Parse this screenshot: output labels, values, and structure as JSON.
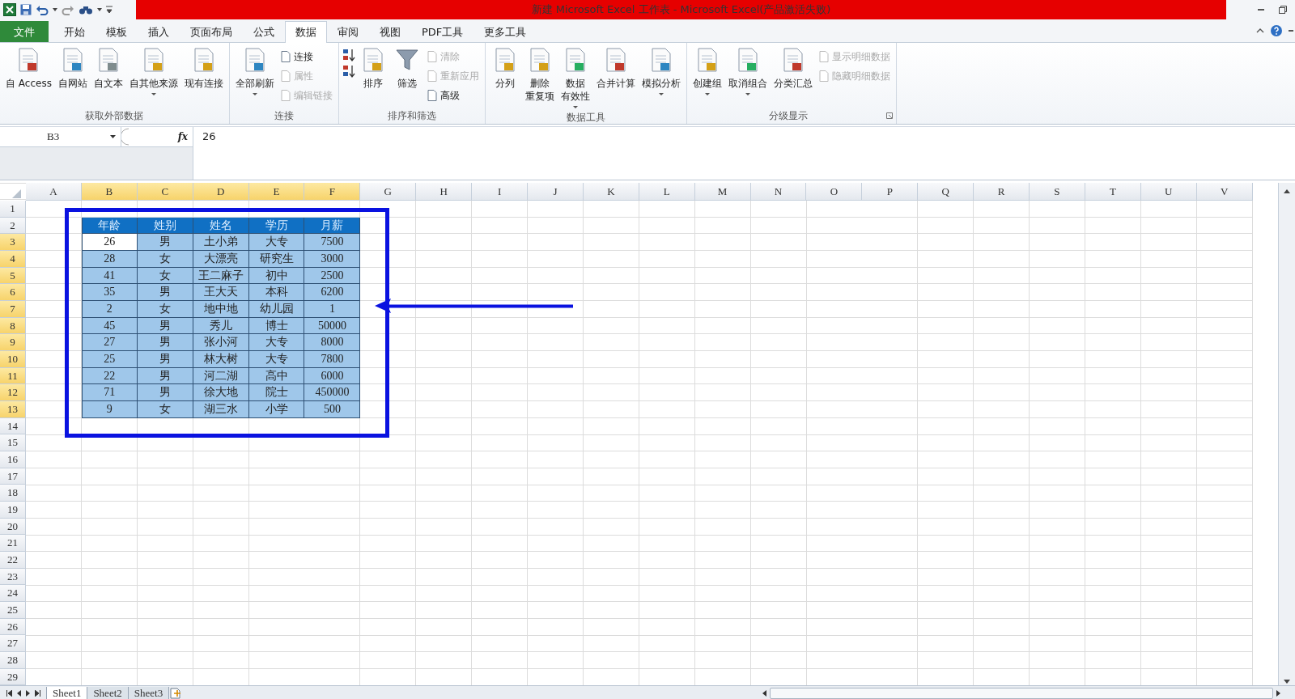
{
  "window": {
    "title": "新建 Microsoft Excel 工作表 - Microsoft Excel(产品激活失败)"
  },
  "menu_tabs": [
    {
      "label": "文件",
      "kind": "file",
      "selected": false
    },
    {
      "label": "开始",
      "kind": "tab",
      "selected": false
    },
    {
      "label": "模板",
      "kind": "tab",
      "selected": false
    },
    {
      "label": "插入",
      "kind": "tab",
      "selected": false
    },
    {
      "label": "页面布局",
      "kind": "tab",
      "selected": false
    },
    {
      "label": "公式",
      "kind": "tab",
      "selected": false
    },
    {
      "label": "数据",
      "kind": "tab",
      "selected": true
    },
    {
      "label": "审阅",
      "kind": "tab",
      "selected": false
    },
    {
      "label": "视图",
      "kind": "tab",
      "selected": false
    },
    {
      "label": "PDF工具",
      "kind": "tab",
      "selected": false
    },
    {
      "label": "更多工具",
      "kind": "tab",
      "selected": false
    }
  ],
  "ribbon": {
    "groups": [
      {
        "label": "获取外部数据",
        "launcher": false,
        "items": [
          {
            "label": "自 Access",
            "kind": "large",
            "dropdown": false,
            "disabled": false
          },
          {
            "label": "自网站",
            "kind": "large",
            "dropdown": false,
            "disabled": false
          },
          {
            "label": "自文本",
            "kind": "large",
            "dropdown": false,
            "disabled": false
          },
          {
            "label": "自其他来源",
            "kind": "large",
            "dropdown": true,
            "disabled": false
          },
          {
            "label": "现有连接",
            "kind": "large",
            "dropdown": false,
            "disabled": false
          }
        ]
      },
      {
        "label": "连接",
        "launcher": false,
        "items": [
          {
            "label": "全部刷新",
            "kind": "large",
            "dropdown": true,
            "disabled": false
          },
          {
            "label": "连接",
            "kind": "small",
            "disabled": false
          },
          {
            "label": "属性",
            "kind": "small",
            "disabled": true
          },
          {
            "label": "编辑链接",
            "kind": "small",
            "disabled": true
          }
        ]
      },
      {
        "label": "排序和筛选",
        "launcher": false,
        "items": [
          {
            "kind": "sortup",
            "disabled": false
          },
          {
            "kind": "sortdown",
            "disabled": false
          },
          {
            "label": "排序",
            "kind": "large",
            "dropdown": false,
            "disabled": false
          },
          {
            "label": "筛选",
            "kind": "funnel",
            "dropdown": false,
            "disabled": false
          },
          {
            "label": "清除",
            "kind": "small",
            "disabled": true
          },
          {
            "label": "重新应用",
            "kind": "small",
            "disabled": true
          },
          {
            "label": "高级",
            "kind": "small",
            "disabled": false
          }
        ]
      },
      {
        "label": "数据工具",
        "launcher": false,
        "items": [
          {
            "label": "分列",
            "kind": "large",
            "dropdown": false,
            "disabled": false
          },
          {
            "lines": [
              "删除",
              "重复项"
            ],
            "kind": "large",
            "dropdown": false,
            "disabled": false
          },
          {
            "lines": [
              "数据",
              "有效性"
            ],
            "kind": "large",
            "dropdown": true,
            "disabled": false
          },
          {
            "label": "合并计算",
            "kind": "large",
            "dropdown": false,
            "disabled": false
          },
          {
            "label": "模拟分析",
            "kind": "large",
            "dropdown": true,
            "disabled": false
          }
        ]
      },
      {
        "label": "分级显示",
        "launcher": true,
        "items": [
          {
            "label": "创建组",
            "kind": "large",
            "dropdown": true,
            "disabled": false
          },
          {
            "label": "取消组合",
            "kind": "large",
            "dropdown": true,
            "disabled": false
          },
          {
            "label": "分类汇总",
            "kind": "large",
            "dropdown": false,
            "disabled": false
          },
          {
            "label": "显示明细数据",
            "kind": "small",
            "disabled": true
          },
          {
            "label": "隐藏明细数据",
            "kind": "small",
            "disabled": true
          }
        ]
      }
    ]
  },
  "formula_bar": {
    "name_box": "B3",
    "function_label": "fx",
    "value": "26"
  },
  "sheet": {
    "columns": [
      {
        "label": "A",
        "selected": false
      },
      {
        "label": "B",
        "selected": true
      },
      {
        "label": "C",
        "selected": true
      },
      {
        "label": "D",
        "selected": true
      },
      {
        "label": "E",
        "selected": true
      },
      {
        "label": "F",
        "selected": true
      },
      {
        "label": "G",
        "selected": false
      },
      {
        "label": "H",
        "selected": false
      },
      {
        "label": "I",
        "selected": false
      },
      {
        "label": "J",
        "selected": false
      },
      {
        "label": "K",
        "selected": false
      },
      {
        "label": "L",
        "selected": false
      },
      {
        "label": "M",
        "selected": false
      },
      {
        "label": "N",
        "selected": false
      },
      {
        "label": "O",
        "selected": false
      },
      {
        "label": "P",
        "selected": false
      },
      {
        "label": "Q",
        "selected": false
      },
      {
        "label": "R",
        "selected": false
      },
      {
        "label": "S",
        "selected": false
      },
      {
        "label": "T",
        "selected": false
      },
      {
        "label": "U",
        "selected": false
      },
      {
        "label": "V",
        "selected": false
      }
    ],
    "rows": [
      {
        "label": "1",
        "selected": false
      },
      {
        "label": "2",
        "selected": false
      },
      {
        "label": "3",
        "selected": true
      },
      {
        "label": "4",
        "selected": true
      },
      {
        "label": "5",
        "selected": true
      },
      {
        "label": "6",
        "selected": true
      },
      {
        "label": "7",
        "selected": true
      },
      {
        "label": "8",
        "selected": true
      },
      {
        "label": "9",
        "selected": true
      },
      {
        "label": "10",
        "selected": true
      },
      {
        "label": "11",
        "selected": true
      },
      {
        "label": "12",
        "selected": true
      },
      {
        "label": "13",
        "selected": true
      },
      {
        "label": "14",
        "selected": false
      },
      {
        "label": "15",
        "selected": false
      },
      {
        "label": "16",
        "selected": false
      },
      {
        "label": "17",
        "selected": false
      },
      {
        "label": "18",
        "selected": false
      },
      {
        "label": "19",
        "selected": false
      },
      {
        "label": "20",
        "selected": false
      },
      {
        "label": "21",
        "selected": false
      },
      {
        "label": "22",
        "selected": false
      },
      {
        "label": "23",
        "selected": false
      },
      {
        "label": "24",
        "selected": false
      },
      {
        "label": "25",
        "selected": false
      },
      {
        "label": "26",
        "selected": false
      },
      {
        "label": "27",
        "selected": false
      },
      {
        "label": "28",
        "selected": false
      },
      {
        "label": "29",
        "selected": false
      }
    ],
    "table": {
      "header": [
        "年龄",
        "姓别",
        "姓名",
        "学历",
        "月薪"
      ],
      "rows": [
        [
          {
            "text": "26",
            "active": true
          },
          {
            "text": "男",
            "active": false
          },
          {
            "text": "土小弟",
            "active": false
          },
          {
            "text": "大专",
            "active": false
          },
          {
            "text": "7500",
            "active": false
          }
        ],
        [
          {
            "text": "28",
            "active": false
          },
          {
            "text": "女",
            "active": false
          },
          {
            "text": "大漂亮",
            "active": false
          },
          {
            "text": "研究生",
            "active": false
          },
          {
            "text": "3000",
            "active": false
          }
        ],
        [
          {
            "text": "41",
            "active": false
          },
          {
            "text": "女",
            "active": false
          },
          {
            "text": "王二麻子",
            "active": false
          },
          {
            "text": "初中",
            "active": false
          },
          {
            "text": "2500",
            "active": false
          }
        ],
        [
          {
            "text": "35",
            "active": false
          },
          {
            "text": "男",
            "active": false
          },
          {
            "text": "王大天",
            "active": false
          },
          {
            "text": "本科",
            "active": false
          },
          {
            "text": "6200",
            "active": false
          }
        ],
        [
          {
            "text": "2",
            "active": false
          },
          {
            "text": "女",
            "active": false
          },
          {
            "text": "地中地",
            "active": false
          },
          {
            "text": "幼儿园",
            "active": false
          },
          {
            "text": "1",
            "active": false
          }
        ],
        [
          {
            "text": "45",
            "active": false
          },
          {
            "text": "男",
            "active": false
          },
          {
            "text": "秀儿",
            "active": false
          },
          {
            "text": "博士",
            "active": false
          },
          {
            "text": "50000",
            "active": false
          }
        ],
        [
          {
            "text": "27",
            "active": false
          },
          {
            "text": "男",
            "active": false
          },
          {
            "text": "张小河",
            "active": false
          },
          {
            "text": "大专",
            "active": false
          },
          {
            "text": "8000",
            "active": false
          }
        ],
        [
          {
            "text": "25",
            "active": false
          },
          {
            "text": "男",
            "active": false
          },
          {
            "text": "林大树",
            "active": false
          },
          {
            "text": "大专",
            "active": false
          },
          {
            "text": "7800",
            "active": false
          }
        ],
        [
          {
            "text": "22",
            "active": false
          },
          {
            "text": "男",
            "active": false
          },
          {
            "text": "河二湖",
            "active": false
          },
          {
            "text": "高中",
            "active": false
          },
          {
            "text": "6000",
            "active": false
          }
        ],
        [
          {
            "text": "71",
            "active": false
          },
          {
            "text": "男",
            "active": false
          },
          {
            "text": "徐大地",
            "active": false
          },
          {
            "text": "院士",
            "active": false
          },
          {
            "text": "450000",
            "active": false
          }
        ],
        [
          {
            "text": "9",
            "active": false
          },
          {
            "text": "女",
            "active": false
          },
          {
            "text": "湖三水",
            "active": false
          },
          {
            "text": "小学",
            "active": false
          },
          {
            "text": "500",
            "active": false
          }
        ]
      ]
    }
  },
  "sheet_tabs": [
    {
      "label": "Sheet1",
      "selected": true
    },
    {
      "label": "Sheet2",
      "selected": false
    },
    {
      "label": "Sheet3",
      "selected": false
    }
  ]
}
